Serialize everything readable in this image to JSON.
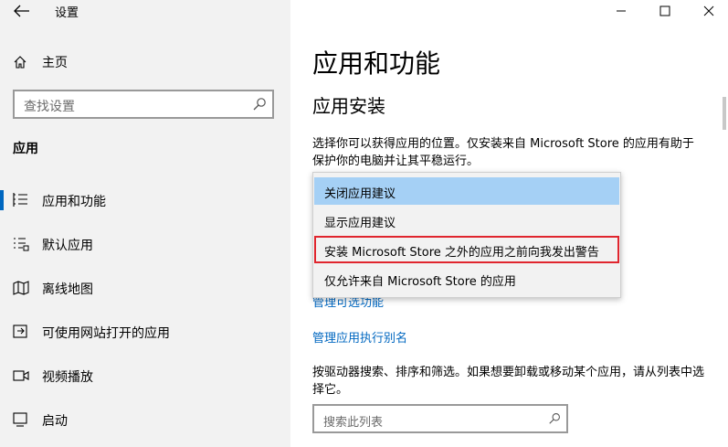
{
  "window": {
    "title": "设置"
  },
  "sidebar": {
    "home_label": "主页",
    "search_placeholder": "查找设置",
    "section_label": "应用",
    "items": [
      {
        "label": "应用和功能",
        "icon": "apps-features-icon",
        "active": true
      },
      {
        "label": "默认应用",
        "icon": "default-apps-icon",
        "active": false
      },
      {
        "label": "离线地图",
        "icon": "offline-maps-icon",
        "active": false
      },
      {
        "label": "可使用网站打开的应用",
        "icon": "apps-for-websites-icon",
        "active": false
      },
      {
        "label": "视频播放",
        "icon": "video-playback-icon",
        "active": false
      },
      {
        "label": "启动",
        "icon": "startup-icon",
        "active": false
      }
    ]
  },
  "main": {
    "page_title": "应用和功能",
    "section_title": "应用安装",
    "description": "选择你可以获得应用的位置。仅安装来自 Microsoft Store 的应用有助于保护你的电脑并让其平稳运行。",
    "dropdown": {
      "options": [
        {
          "label": "关闭应用建议",
          "selected": true
        },
        {
          "label": "显示应用建议",
          "selected": false
        },
        {
          "label": "安装 Microsoft Store 之外的应用之前向我发出警告",
          "selected": false,
          "highlighted": true
        },
        {
          "label": "仅允许来自 Microsoft Store 的应用",
          "selected": false
        }
      ]
    },
    "link_optional_features": "管理可选功能",
    "link_app_alias": "管理应用执行别名",
    "search_description": "按驱动器搜索、排序和筛选。如果想要卸载或移动某个应用，请从列表中选择它。",
    "search_placeholder": "搜索此列表"
  },
  "colors": {
    "accent": "#0067c0",
    "selection": "#a5d0f5",
    "highlight_border": "#e0262e",
    "sidebar_bg": "#f2f2f2"
  }
}
